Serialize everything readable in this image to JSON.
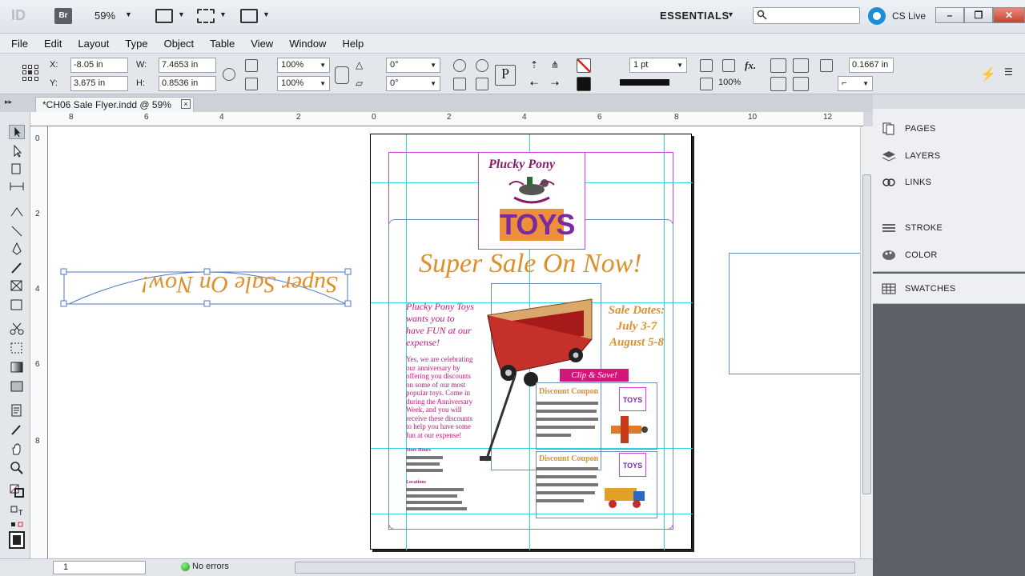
{
  "titlebar": {
    "app_logo": "ID",
    "bridge": "Br",
    "zoom": "59%",
    "workspace": "ESSENTIALS",
    "search_placeholder": "",
    "cs_live": "CS Live"
  },
  "menu": [
    "File",
    "Edit",
    "Layout",
    "Type",
    "Object",
    "Table",
    "View",
    "Window",
    "Help"
  ],
  "control": {
    "x_label": "X:",
    "x_value": "-8.05 in",
    "y_label": "Y:",
    "y_value": "3.675 in",
    "w_label": "W:",
    "w_value": "7.4653 in",
    "h_label": "H:",
    "h_value": "0.8536 in",
    "scale_x": "100%",
    "scale_y": "100%",
    "rotate": "0°",
    "shear": "0°",
    "stroke_weight": "1 pt",
    "opacity": "100%",
    "offset": "0.1667 in"
  },
  "document": {
    "tab_title": "*CH06 Sale Flyer.indd @ 59%",
    "tab_close": "×"
  },
  "ruler_h": [
    "8",
    "6",
    "4",
    "2",
    "0",
    "2",
    "4",
    "6",
    "8",
    "10",
    "12"
  ],
  "ruler_v": [
    "0",
    "2",
    "4",
    "6",
    "8"
  ],
  "flyer": {
    "logo_line1": "Plucky Pony",
    "logo_toys": "TOYS",
    "headline": "Super Sale On Now!",
    "intro": "Plucky Pony Toys wants you to have FUN at our expense!",
    "body": "Yes, we are celebrating our anniversary by offering you discounts on some of our most popular toys. Come in during the Anniversary Week, and you will receive these discounts to help you have some fun at our expense!",
    "label_store": "Store Hours",
    "label_locations": "Locations",
    "sale_dates": "Sale Dates:",
    "dates_1": "July 3-7",
    "dates_2": "August 5-8",
    "clip_save": "Clip & Save!",
    "coupon_1": "Discount Coupon",
    "coupon_2": "Discount Coupon",
    "mini_logo": "TOYS"
  },
  "path_text": "Super Sale On Now!",
  "status": {
    "page": "1",
    "errors": "No errors"
  },
  "panels": [
    "PAGES",
    "LAYERS",
    "LINKS",
    "STROKE",
    "COLOR",
    "SWATCHES"
  ],
  "colors": {
    "headline": "#df8f2a",
    "body_text": "#c0167a",
    "margin_guide": "#d23fd2",
    "column_guide": "#34d4e0"
  }
}
